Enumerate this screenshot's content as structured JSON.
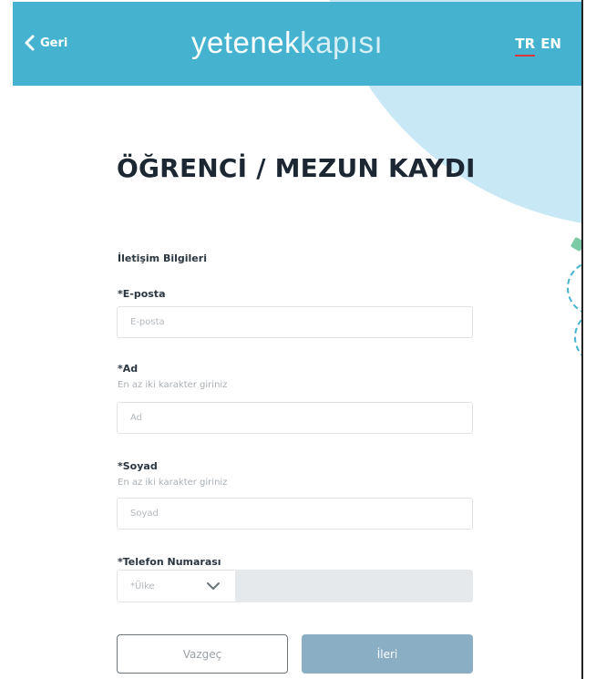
{
  "header": {
    "back_label": "Geri",
    "logo_bold": "yetenek",
    "logo_light": "kapısı",
    "lang_tr": "TR",
    "lang_en": "EN"
  },
  "page": {
    "title": "ÖĞRENCİ / MEZUN KAYDI",
    "section_title": "İletişim Bilgileri"
  },
  "form": {
    "email": {
      "label": "*E-posta",
      "placeholder": "E-posta"
    },
    "name": {
      "label": "*Ad",
      "hint": "En az iki karakter giriniz",
      "placeholder": "Ad"
    },
    "surname": {
      "label": "*Soyad",
      "hint": "En az iki karakter giriniz",
      "placeholder": "Soyad"
    },
    "phone": {
      "label": "*Telefon Numarası",
      "country_placeholder": "*Ülke"
    }
  },
  "actions": {
    "cancel_label": "Vazgeç",
    "next_label": "İleri"
  },
  "colors": {
    "header_bg": "#45b3cf",
    "accent_decoration": "#c9e8f6",
    "next_button_bg": "#8aaec4",
    "lang_underline": "#d9333b"
  },
  "icons": [
    "chevron-left-icon",
    "chevron-down-icon"
  ]
}
